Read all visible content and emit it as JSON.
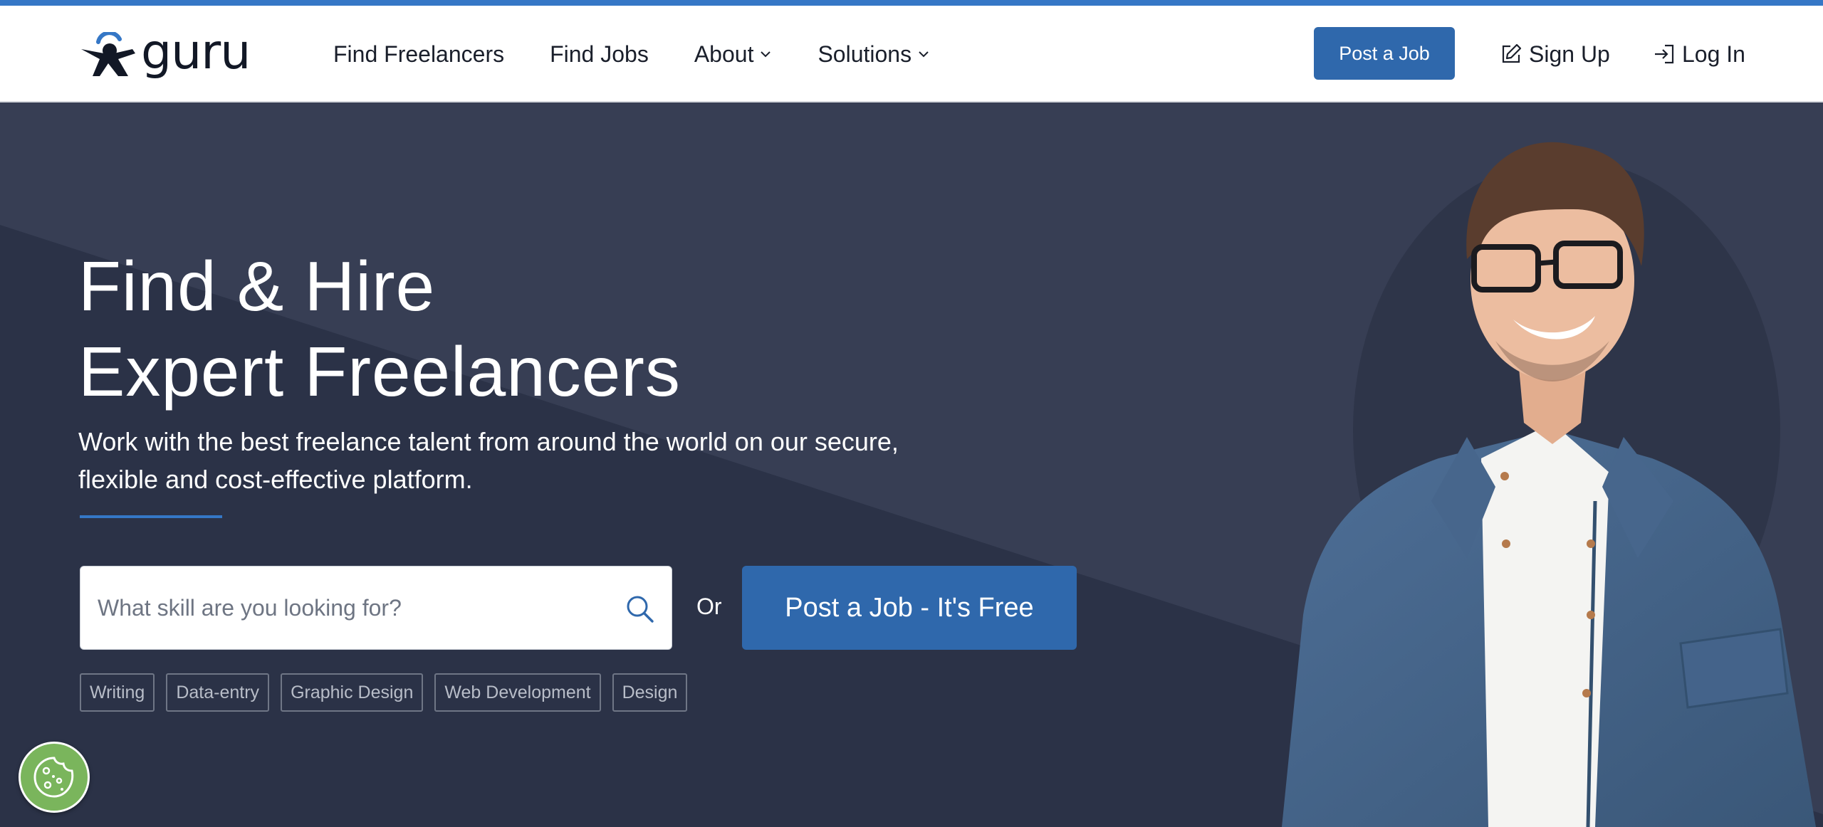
{
  "brand": {
    "name": "guru"
  },
  "nav": {
    "items": [
      {
        "label": "Find Freelancers",
        "dropdown": false
      },
      {
        "label": "Find Jobs",
        "dropdown": false
      },
      {
        "label": "About",
        "dropdown": true
      },
      {
        "label": "Solutions",
        "dropdown": true
      }
    ],
    "post_job_label": "Post a Job",
    "signup_label": "Sign Up",
    "login_label": "Log In"
  },
  "hero": {
    "title_line1": "Find & Hire",
    "title_line2": "Expert Freelancers",
    "subtitle_line1": "Work with the best freelance talent from around the world on our secure,",
    "subtitle_line2": "flexible and cost-effective platform.",
    "search_placeholder": "What skill are you looking for?",
    "search_value": "",
    "or_label": "Or",
    "cta_label": "Post a Job - It's Free",
    "tags": [
      "Writing",
      "Data-entry",
      "Graphic Design",
      "Web Development",
      "Design"
    ]
  },
  "icons": {
    "logo": "guru-logo-icon",
    "chevron": "chevron-down-icon",
    "signup": "edit-icon",
    "login": "login-icon",
    "search": "search-icon",
    "cookie": "cookie-icon"
  },
  "colors": {
    "accent": "#3577c6",
    "primary_button": "#2f68ac",
    "hero_background": "#2b3247",
    "cookie_badge": "#7ab55c"
  }
}
